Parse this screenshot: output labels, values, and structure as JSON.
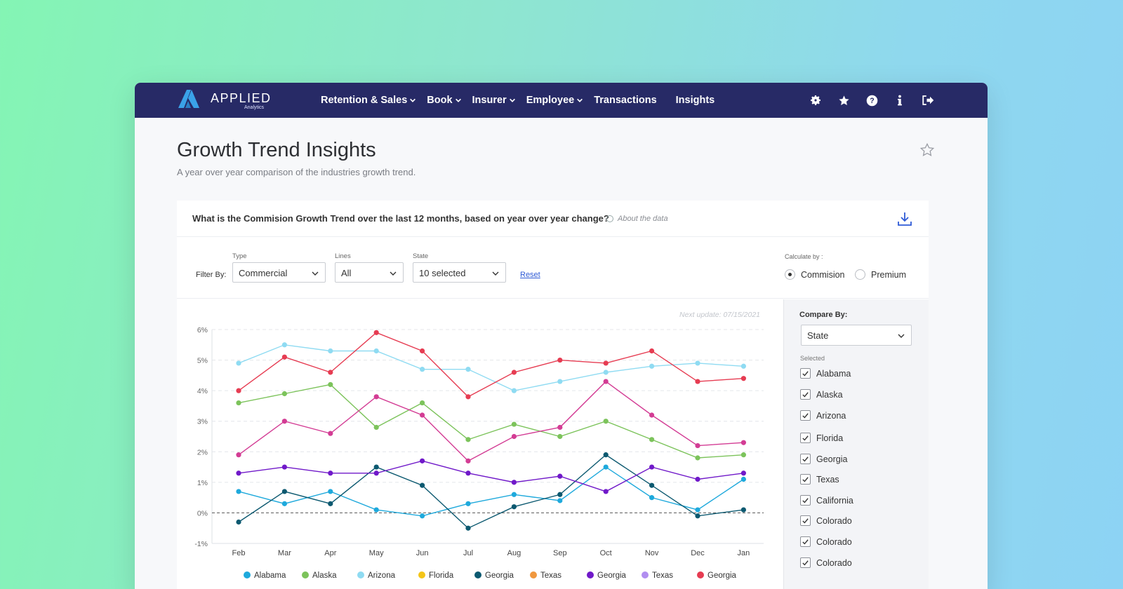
{
  "brand": {
    "name": "APPLIED",
    "sub": "Analytics",
    "accent": "#3aa2e8"
  },
  "nav": {
    "items": [
      {
        "label": "Retention & Sales",
        "dropdown": true
      },
      {
        "label": "Book",
        "dropdown": true
      },
      {
        "label": "Insurer",
        "dropdown": true
      },
      {
        "label": "Employee",
        "dropdown": true
      },
      {
        "label": "Transactions",
        "dropdown": false
      },
      {
        "label": "Insights",
        "dropdown": false
      }
    ],
    "icons": [
      "gear-icon",
      "star-icon",
      "help-icon",
      "info-icon",
      "logout-icon"
    ],
    "bg": "#272a66"
  },
  "page": {
    "title": "Growth Trend Insights",
    "subtitle": "A year over year comparison of the industries growth trend."
  },
  "question": {
    "text": "What is the Commision Growth Trend over the last 12 months, based on year over year change?",
    "about": "About the data"
  },
  "filters": {
    "filter_by": "Filter By:",
    "type": {
      "label": "Type",
      "value": "Commercial"
    },
    "lines": {
      "label": "Lines",
      "value": "All"
    },
    "state": {
      "label": "State",
      "value": "10 selected"
    },
    "reset": "Reset",
    "calculate_by": "Calculate by :",
    "options": [
      {
        "label": "Commision",
        "selected": true
      },
      {
        "label": "Premium",
        "selected": false
      }
    ]
  },
  "next_update": "Next update:  07/15/2021",
  "compare": {
    "label": "Compare By:",
    "value": "State",
    "selected_label": "Selected",
    "items": [
      "Alabama",
      "Alaska",
      "Arizona",
      "Florida",
      "Georgia",
      "Texas",
      "California",
      "Colorado",
      "Colorado",
      "Colorado"
    ]
  },
  "chart_data": {
    "type": "line",
    "x": [
      "Feb",
      "Mar",
      "Apr",
      "May",
      "Jun",
      "Jul",
      "Aug",
      "Sep",
      "Oct",
      "Nov",
      "Dec",
      "Jan"
    ],
    "yticks": [
      "6%",
      "5%",
      "4%",
      "3%",
      "2%",
      "1%",
      "0%",
      "-1%"
    ],
    "ylim": [
      -1,
      6
    ],
    "series": [
      {
        "name": "Alabama",
        "color": "#1ea9dc",
        "values": [
          0.7,
          0.3,
          0.7,
          0.1,
          -0.1,
          0.3,
          0.6,
          0.4,
          1.5,
          0.5,
          0.1,
          1.1
        ]
      },
      {
        "name": "Alaska",
        "color": "#7cc35b",
        "values": [
          3.6,
          3.9,
          4.2,
          2.8,
          3.6,
          2.4,
          2.9,
          2.5,
          3.0,
          2.4,
          1.8,
          1.9
        ]
      },
      {
        "name": "Arizona",
        "color": "#8fdbf2",
        "values": [
          4.9,
          5.5,
          5.3,
          5.3,
          4.7,
          4.7,
          4.0,
          4.3,
          4.6,
          4.8,
          4.9,
          4.8
        ]
      },
      {
        "name": "Florida",
        "color": "#f4c518",
        "values": []
      },
      {
        "name": "Georgia",
        "color": "#0c5970",
        "values": [
          -0.3,
          0.7,
          0.3,
          1.5,
          0.9,
          -0.5,
          0.2,
          0.6,
          1.9,
          0.9,
          -0.1,
          0.1
        ]
      },
      {
        "name": "Texas",
        "color": "#f0983f",
        "values": []
      },
      {
        "name": "Georgia",
        "color": "#7019c9",
        "values": [
          1.3,
          1.5,
          1.3,
          1.3,
          1.7,
          1.3,
          1.0,
          1.2,
          0.7,
          1.5,
          1.1,
          1.3
        ]
      },
      {
        "name": "Texas",
        "color": "#b18ef0",
        "values": []
      },
      {
        "name": "Georgia",
        "color": "#e63c52",
        "values": [
          4.0,
          5.1,
          4.6,
          5.9,
          5.3,
          3.8,
          4.6,
          5.0,
          4.9,
          5.3,
          4.3,
          4.4
        ]
      }
    ],
    "extra_series": [
      {
        "name": "",
        "color": "#d33c94",
        "values": [
          1.9,
          3.0,
          2.6,
          3.8,
          3.2,
          1.7,
          2.5,
          2.8,
          4.3,
          3.2,
          2.2,
          2.3
        ]
      }
    ],
    "grid": true,
    "legend": "bottom"
  }
}
